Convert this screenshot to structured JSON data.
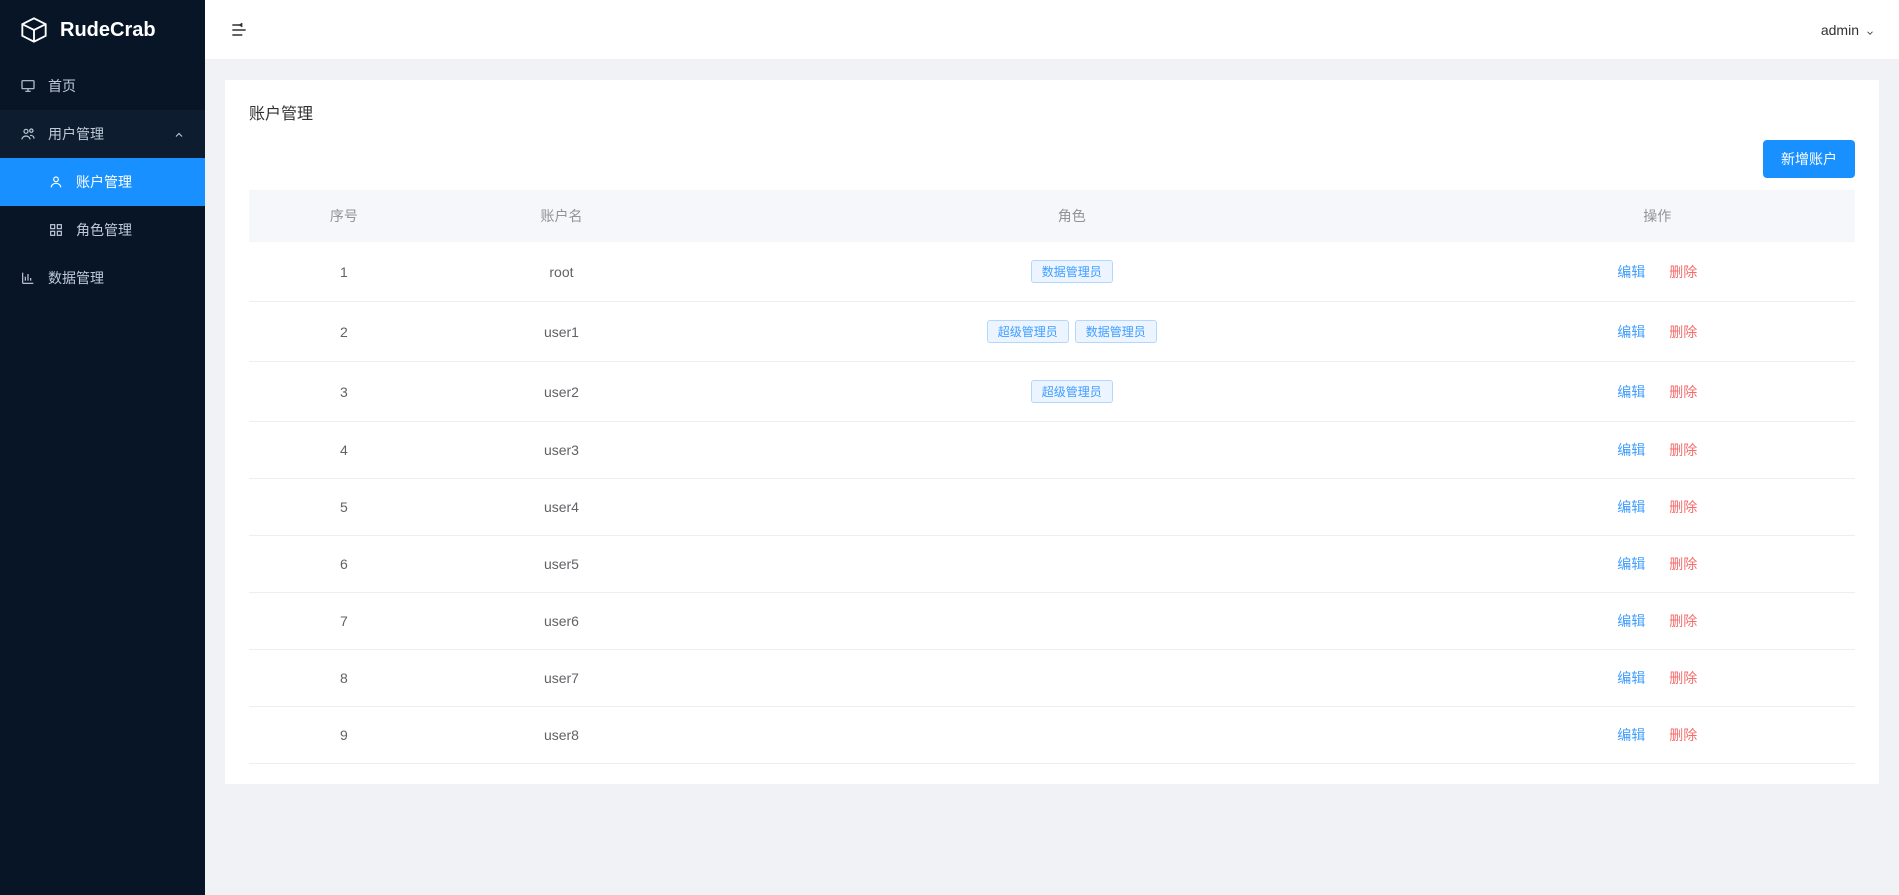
{
  "brand": {
    "name": "RudeCrab"
  },
  "sidebar": {
    "home": "首页",
    "user_mgmt": "用户管理",
    "account_mgmt": "账户管理",
    "role_mgmt": "角色管理",
    "data_mgmt": "数据管理"
  },
  "header": {
    "user": "admin"
  },
  "page": {
    "title": "账户管理",
    "add_button": "新增账户",
    "columns": {
      "index": "序号",
      "username": "账户名",
      "role": "角色",
      "actions": "操作"
    },
    "actions": {
      "edit": "编辑",
      "delete": "删除"
    },
    "role_labels": {
      "data_admin": "数据管理员",
      "super_admin": "超级管理员"
    },
    "rows": [
      {
        "index": "1",
        "username": "root",
        "roles": [
          "data_admin"
        ]
      },
      {
        "index": "2",
        "username": "user1",
        "roles": [
          "super_admin",
          "data_admin"
        ]
      },
      {
        "index": "3",
        "username": "user2",
        "roles": [
          "super_admin"
        ]
      },
      {
        "index": "4",
        "username": "user3",
        "roles": []
      },
      {
        "index": "5",
        "username": "user4",
        "roles": []
      },
      {
        "index": "6",
        "username": "user5",
        "roles": []
      },
      {
        "index": "7",
        "username": "user6",
        "roles": []
      },
      {
        "index": "8",
        "username": "user7",
        "roles": []
      },
      {
        "index": "9",
        "username": "user8",
        "roles": []
      }
    ]
  }
}
